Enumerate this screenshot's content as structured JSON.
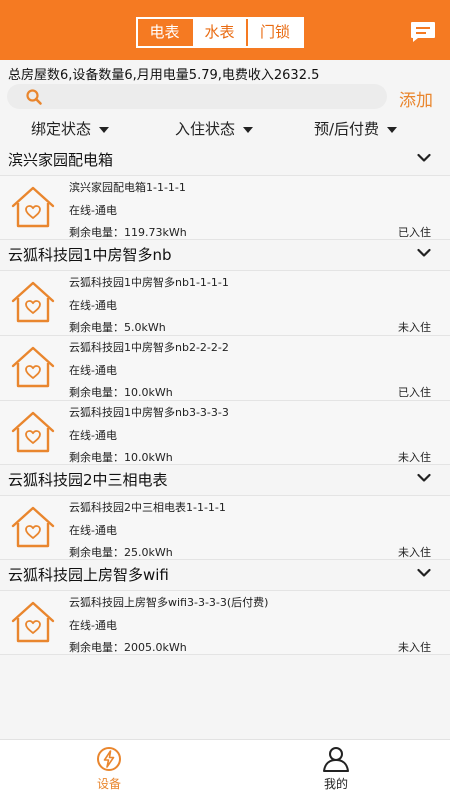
{
  "header": {
    "tabs": [
      {
        "label": "电表",
        "active": true
      },
      {
        "label": "水表",
        "active": false
      },
      {
        "label": "门锁",
        "active": false
      }
    ],
    "message_icon": "message-icon"
  },
  "summary": "总房屋数6,设备数量6,月用电量5.79,电费收入2632.5",
  "search": {
    "placeholder": "",
    "icon": "search-icon"
  },
  "add_label": "添加",
  "filters": [
    {
      "label": "绑定状态"
    },
    {
      "label": "入住状态"
    },
    {
      "label": "预/后付费"
    }
  ],
  "groups": [
    {
      "title": "滨兴家园配电箱",
      "devices": [
        {
          "name": "滨兴家园配电箱1-1-1-1",
          "status": "在线-通电",
          "power_label": "剩余电量：",
          "power": "119.73kWh",
          "occupancy": "已入住"
        }
      ]
    },
    {
      "title": "云狐科技园1中房智多nb",
      "devices": [
        {
          "name": "云狐科技园1中房智多nb1-1-1-1",
          "status": "在线-通电",
          "power_label": "剩余电量：",
          "power": "5.0kWh",
          "occupancy": "未入住"
        },
        {
          "name": "云狐科技园1中房智多nb2-2-2-2",
          "status": "在线-通电",
          "power_label": "剩余电量：",
          "power": "10.0kWh",
          "occupancy": "已入住"
        },
        {
          "name": "云狐科技园1中房智多nb3-3-3-3",
          "status": "在线-通电",
          "power_label": "剩余电量：",
          "power": "10.0kWh",
          "occupancy": "未入住"
        }
      ]
    },
    {
      "title": "云狐科技园2中三相电表",
      "devices": [
        {
          "name": "云狐科技园2中三相电表1-1-1-1",
          "status": "在线-通电",
          "power_label": "剩余电量：",
          "power": "25.0kWh",
          "occupancy": "未入住"
        }
      ]
    },
    {
      "title": "云狐科技园上房智多wifi",
      "devices": [
        {
          "name": "云狐科技园上房智多wifi3-3-3-3(后付费)",
          "status": "在线-通电",
          "power_label": "剩余电量：",
          "power": "2005.0kWh",
          "occupancy": "未入住"
        }
      ]
    }
  ],
  "bottom_nav": [
    {
      "label": "设备",
      "icon": "lightning-icon",
      "active": true
    },
    {
      "label": "我的",
      "icon": "person-icon",
      "active": false
    }
  ],
  "colors": {
    "accent": "#f57a22",
    "accent_text": "#e9862e"
  }
}
